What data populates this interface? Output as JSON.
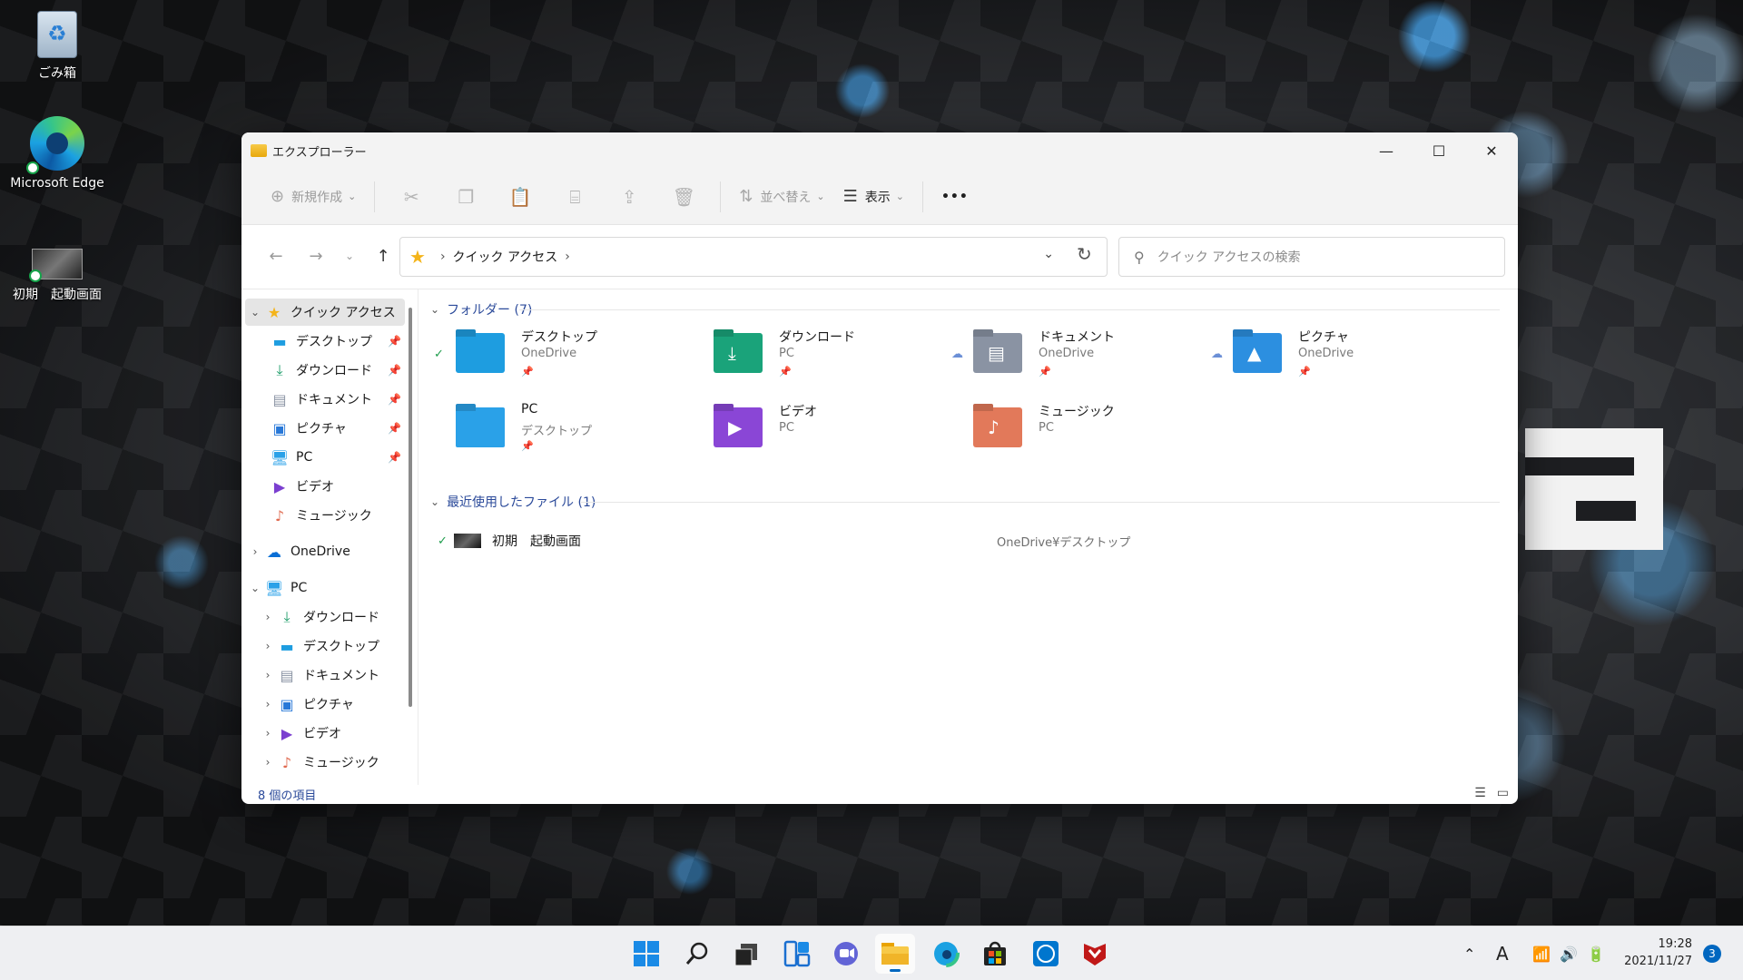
{
  "desktop": {
    "icons": [
      {
        "label": "ごみ箱"
      },
      {
        "label": "Microsoft Edge"
      },
      {
        "label": "初期　起動画面"
      }
    ]
  },
  "window": {
    "title": "エクスプローラー",
    "controls": {
      "minimize": "—",
      "maximize": "☐",
      "close": "✕"
    }
  },
  "commandbar": {
    "new_label": "新規作成",
    "sort_label": "並べ替え",
    "view_label": "表示",
    "more_label": "•••"
  },
  "address": {
    "breadcrumb": "クイック アクセス",
    "search_placeholder": "クイック アクセスの検索"
  },
  "nav": {
    "quick_access": "クイック アクセス",
    "quick_items": [
      {
        "label": "デスクトップ",
        "icon": "desktop-folder-icon",
        "color": "#1e9de0"
      },
      {
        "label": "ダウンロード",
        "icon": "download-icon",
        "color": "#1e9d6a"
      },
      {
        "label": "ドキュメント",
        "icon": "document-icon",
        "color": "#8a93a3"
      },
      {
        "label": "ピクチャ",
        "icon": "picture-icon",
        "color": "#2878d8"
      },
      {
        "label": "PC",
        "icon": "pc-icon",
        "color": "#2aa1e8"
      },
      {
        "label": "ビデオ",
        "icon": "video-icon",
        "color": "#7b3fd0"
      },
      {
        "label": "ミュージック",
        "icon": "music-icon",
        "color": "#e06a50"
      }
    ],
    "onedrive": "OneDrive",
    "pc": "PC",
    "pc_items": [
      {
        "label": "ダウンロード"
      },
      {
        "label": "デスクトップ"
      },
      {
        "label": "ドキュメント"
      },
      {
        "label": "ピクチャ"
      },
      {
        "label": "ビデオ"
      },
      {
        "label": "ミュージック"
      }
    ]
  },
  "content": {
    "folders_header": "フォルダー (7)",
    "folders": [
      {
        "name": "デスクトップ",
        "location": "OneDrive",
        "pinned": true,
        "status": "ok",
        "color": "#1e9de0"
      },
      {
        "name": "ダウンロード",
        "location": "PC",
        "pinned": true,
        "status": "",
        "color": "#1aa37a"
      },
      {
        "name": "ドキュメント",
        "location": "OneDrive",
        "pinned": true,
        "status": "cloud",
        "color": "#8a93a3"
      },
      {
        "name": "ピクチャ",
        "location": "OneDrive",
        "pinned": true,
        "status": "cloud",
        "color": "#2c8fe0"
      },
      {
        "name": "PC",
        "location": "デスクトップ",
        "pinned": true,
        "status": "",
        "color": "#2aa1e8"
      },
      {
        "name": "ビデオ",
        "location": "PC",
        "pinned": false,
        "status": "",
        "color": "#8a46d6"
      },
      {
        "name": "ミュージック",
        "location": "PC",
        "pinned": false,
        "status": "",
        "color": "#e2795a"
      }
    ],
    "recent_header": "最近使用したファイル (1)",
    "recent": [
      {
        "name": "初期　起動画面",
        "location": "OneDrive¥デスクトップ"
      }
    ]
  },
  "statusbar": {
    "count": "8 個の項目"
  },
  "taskbar": {
    "apps": [
      "start-icon",
      "search-icon",
      "task-view-icon",
      "widgets-icon",
      "chat-icon",
      "file-explorer-icon",
      "edge-icon",
      "store-icon",
      "dell-icon",
      "mcafee-icon"
    ],
    "tray": {
      "ime": "A"
    },
    "time": "19:28",
    "date": "2021/11/27",
    "notifications": "3"
  }
}
